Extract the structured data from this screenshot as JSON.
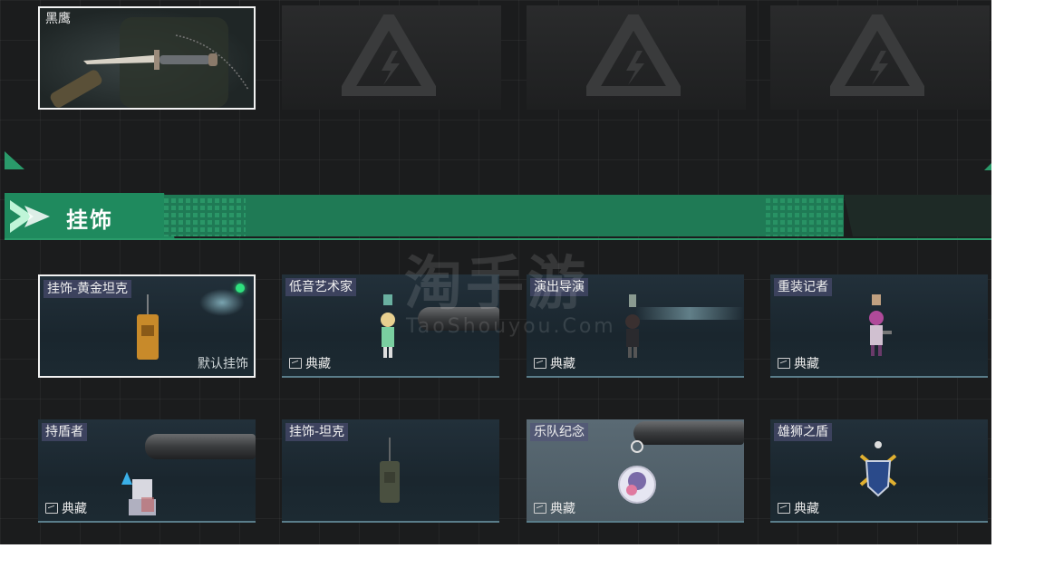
{
  "weapon_skins": {
    "selected": {
      "name": "黑鹰"
    },
    "locked_count": 3
  },
  "section": {
    "title": "挂饰"
  },
  "accessories": [
    {
      "name": "挂饰-黄金坦克",
      "default_label": "默认挂饰",
      "equipped": true
    },
    {
      "name": "低音艺术家",
      "tag": "典藏"
    },
    {
      "name": "演出导演",
      "tag": "典藏"
    },
    {
      "name": "重装记者",
      "tag": "典藏"
    },
    {
      "name": "持盾者",
      "tag": "典藏"
    },
    {
      "name": "挂饰-坦克"
    },
    {
      "name": "乐队纪念",
      "tag": "典藏"
    },
    {
      "name": "雄狮之盾",
      "tag": "典藏"
    }
  ],
  "watermark": {
    "main": "淘手游",
    "sub": "TaoShouyou.Com"
  },
  "colors": {
    "accent_green": "#2a9a6a",
    "equipped_dot": "#2fe07e",
    "background": "#1b1c1d"
  },
  "icons": {
    "collection_tag": "landscape-picture-icon",
    "locked": "lightning-triangle-logo-icon",
    "section": "chevron-arrow-icon"
  }
}
